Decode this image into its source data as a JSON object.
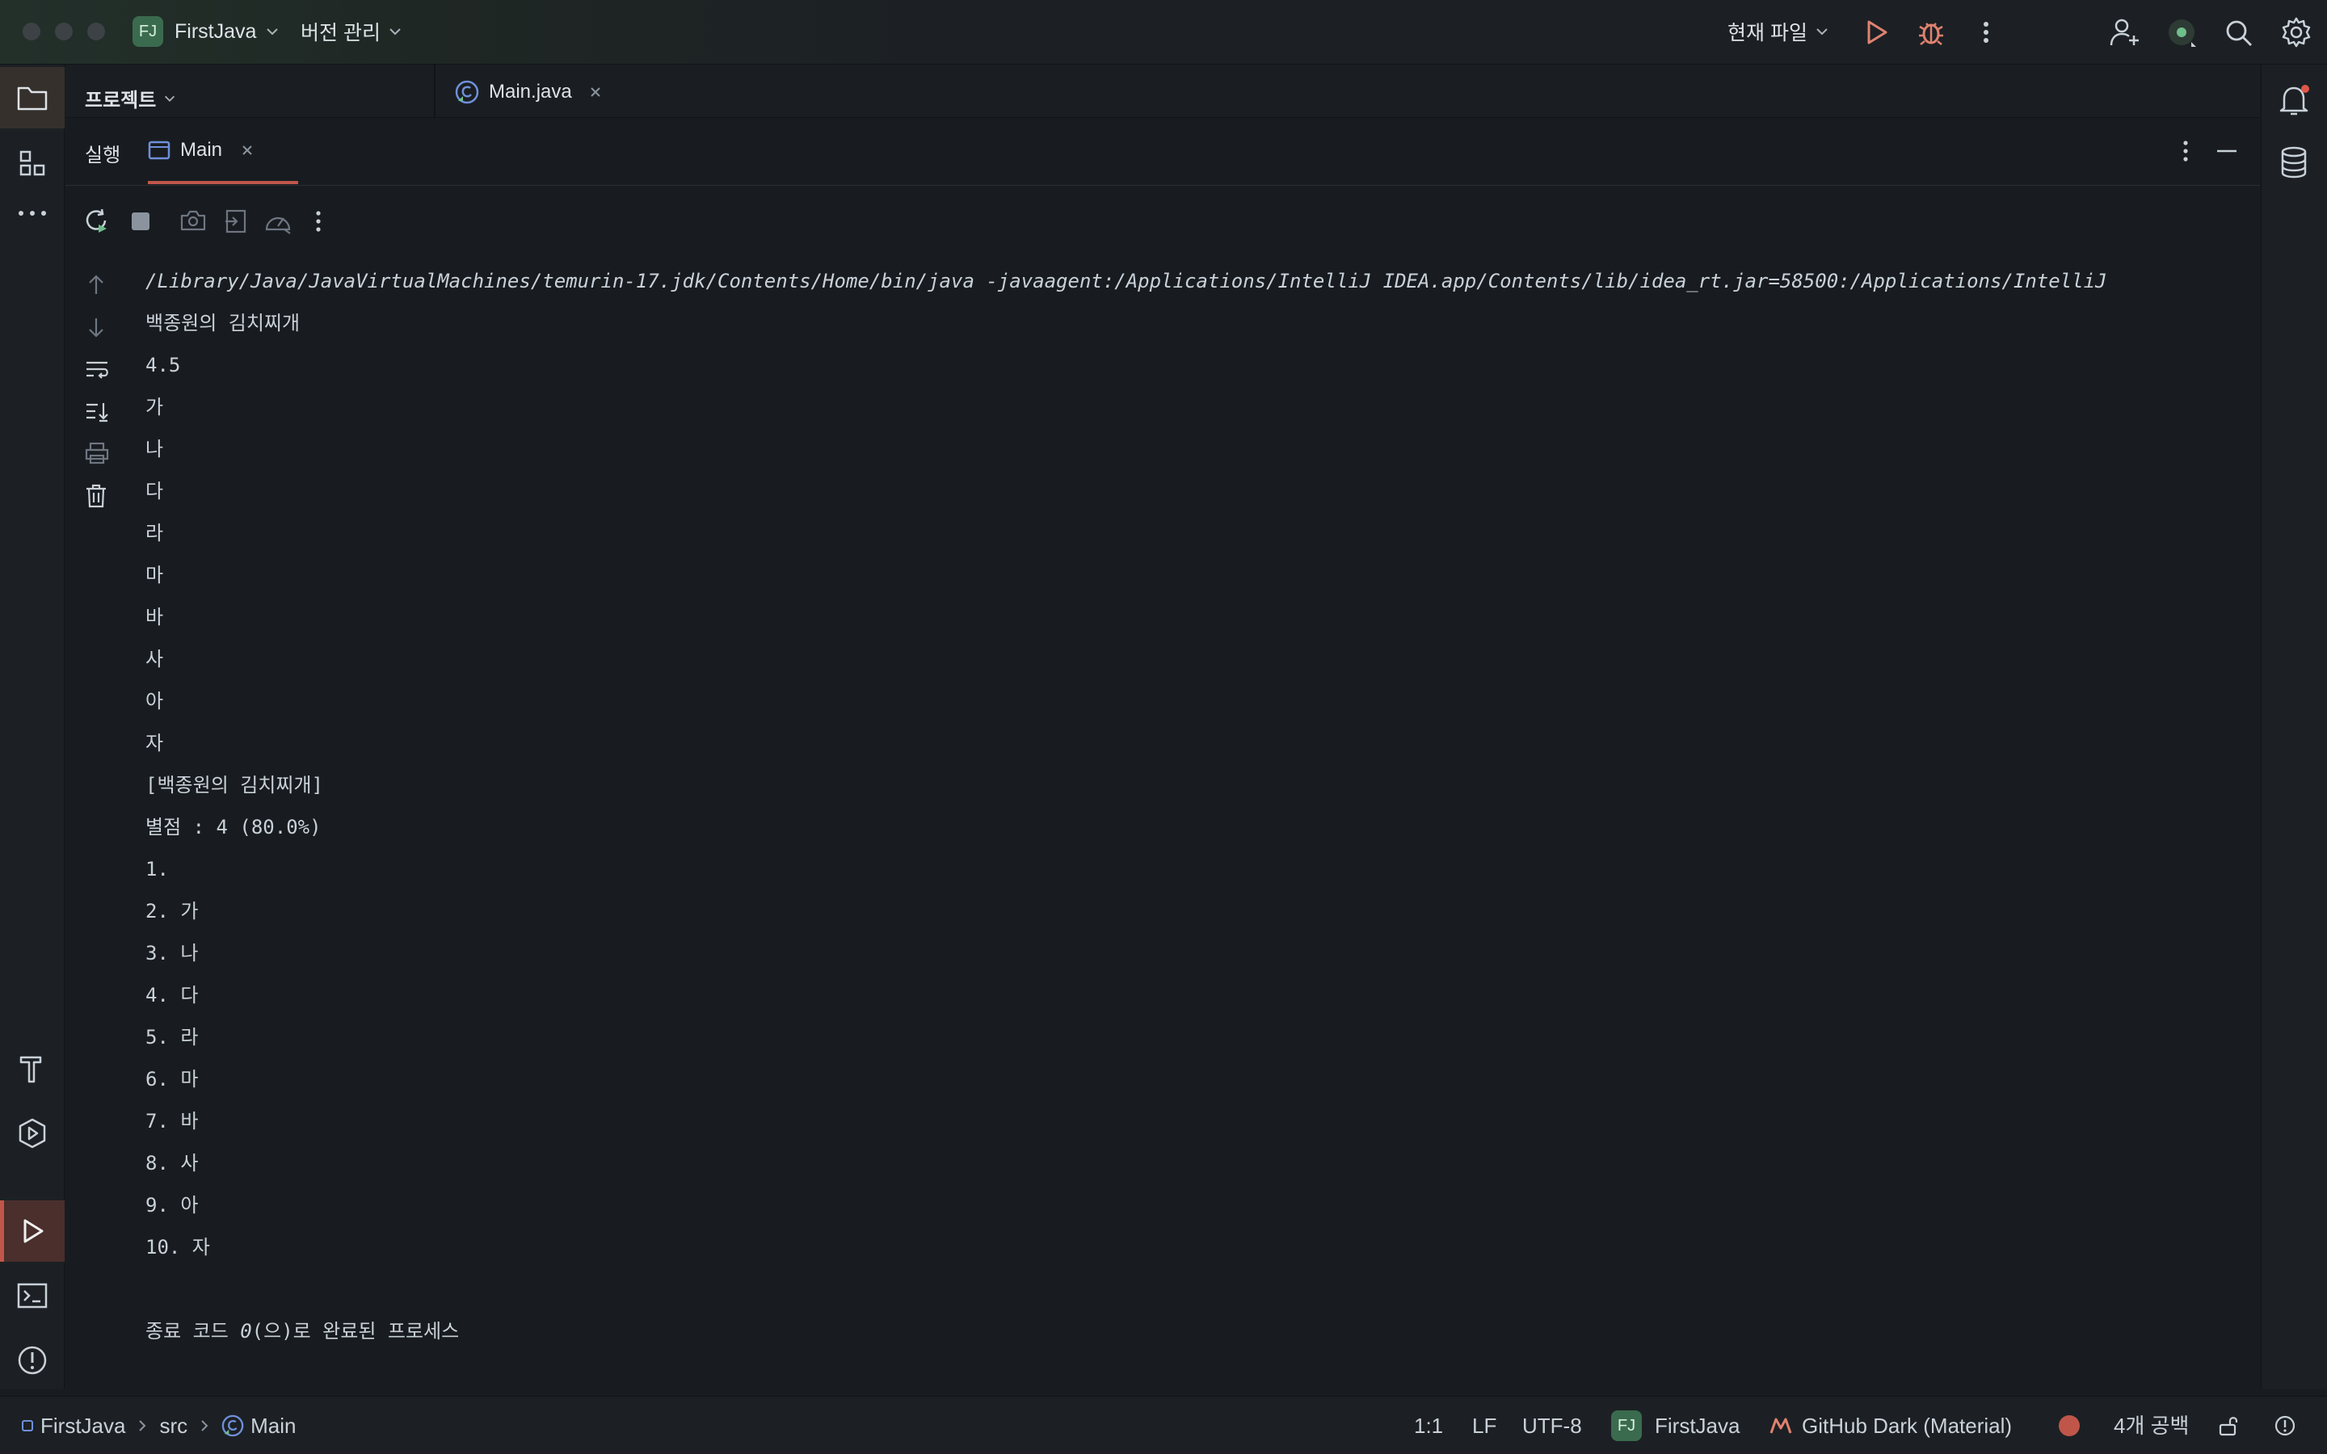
{
  "titlebar": {
    "project_badge": "FJ",
    "project_name": "FirstJava",
    "vcs_label": "버전 관리",
    "run_config": "현재 파일"
  },
  "project_panel": {
    "title": "프로젝트"
  },
  "editor_tabs": [
    {
      "label": "Main.java"
    }
  ],
  "run_panel": {
    "title": "실행",
    "tab_label": "Main"
  },
  "console": {
    "command": "/Library/Java/JavaVirtualMachines/temurin-17.jdk/Contents/Home/bin/java -javaagent:/Applications/IntelliJ IDEA.app/Contents/lib/idea_rt.jar=58500:/Applications/IntelliJ",
    "lines": [
      "백종원의 김치찌개",
      "4.5",
      "가",
      "나",
      "다",
      "라",
      "마",
      "바",
      "사",
      "아",
      "자",
      "[백종원의 김치찌개]",
      "별점 : 4 (80.0%)",
      "1.",
      "2. 가",
      "3. 나",
      "4. 다",
      "5. 라",
      "6. 마",
      "7. 바",
      "8. 사",
      "9. 아",
      "10. 자",
      ""
    ],
    "exit_prefix": "종료 코드 ",
    "exit_code": "0",
    "exit_suffix": "(으)로 완료된 프로세스"
  },
  "statusbar": {
    "breadcrumb": [
      "FirstJava",
      "src",
      "Main"
    ],
    "position": "1:1",
    "line_ending": "LF",
    "encoding": "UTF-8",
    "project_badge": "FJ",
    "project_name": "FirstJava",
    "theme": "GitHub Dark (Material)",
    "indent": "4개 공백"
  },
  "colors": {
    "accent_red": "#c0564a",
    "run_green": "#e0826f",
    "project_badge_bg": "#3b6b4f"
  }
}
